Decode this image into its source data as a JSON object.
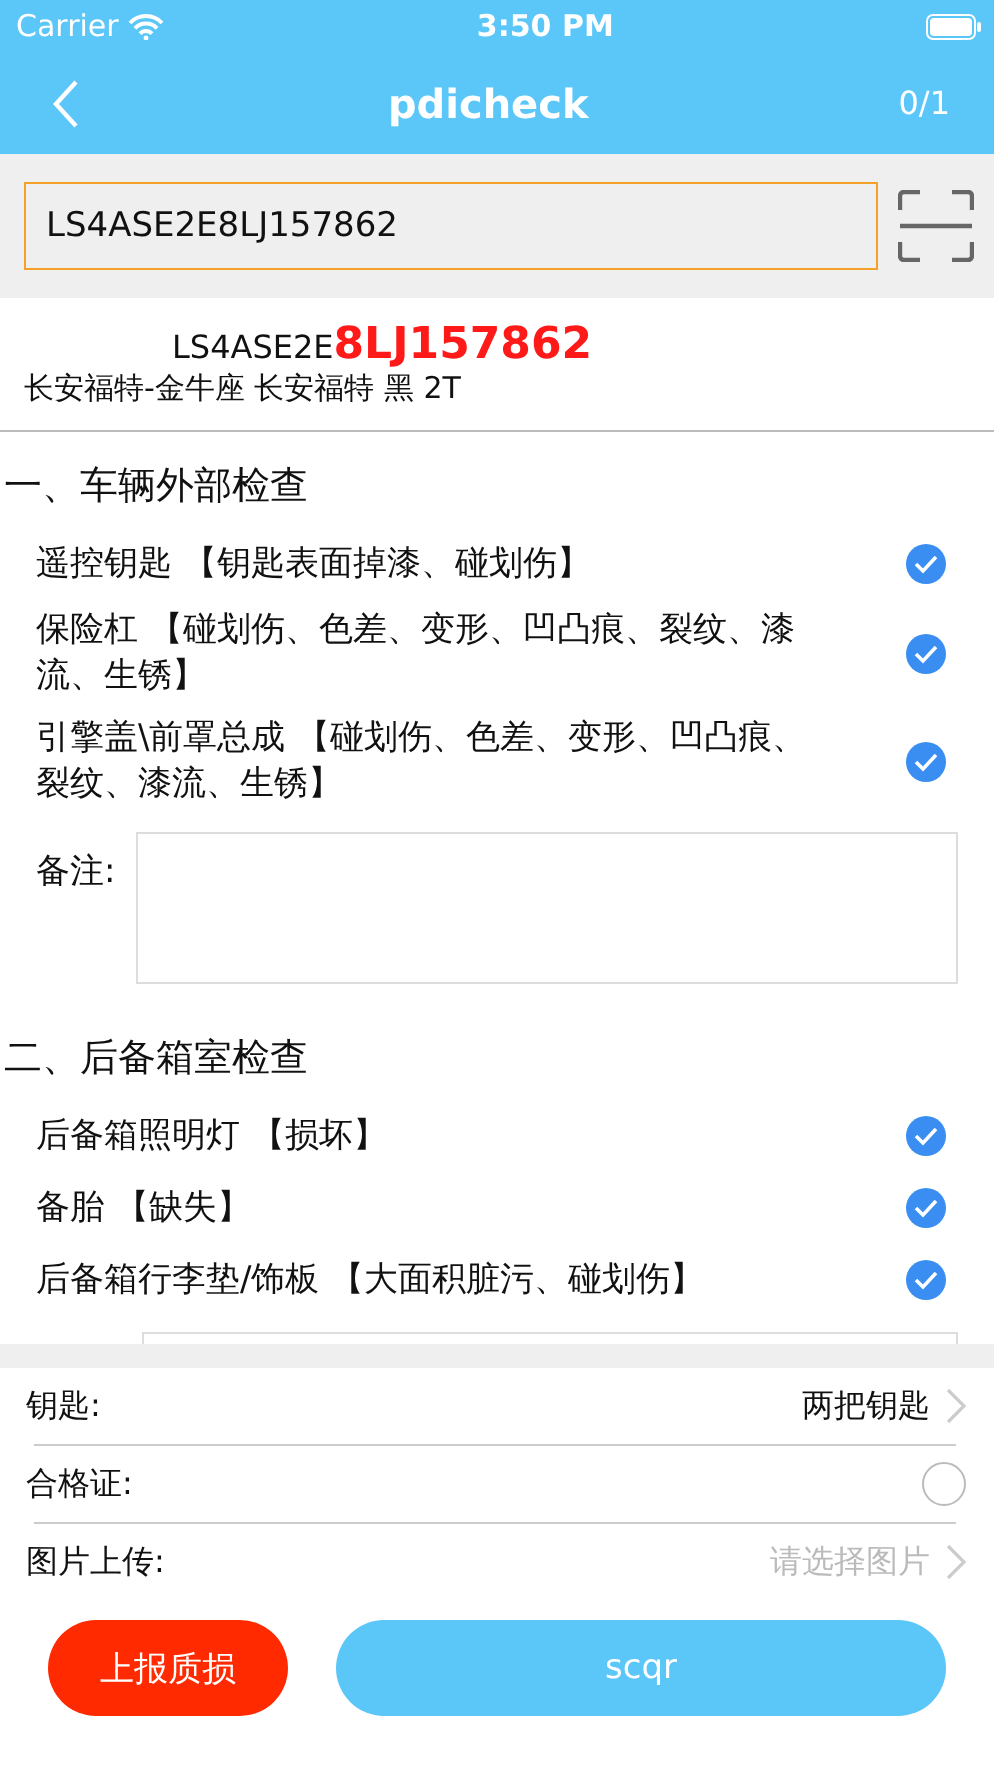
{
  "status_bar": {
    "carrier": "Carrier",
    "time": "3:50 PM"
  },
  "nav": {
    "title": "pdicheck",
    "counter": "0/1"
  },
  "search": {
    "value": "LS4ASE2E8LJ157862"
  },
  "vehicle": {
    "vin_prefix": "LS4ASE2E",
    "vin_suffix": "8LJ157862",
    "description": "长安福特-金牛座 长安福特  黑  2T"
  },
  "sections": [
    {
      "title": "一、车辆外部检查",
      "items": [
        {
          "label": "遥控钥匙 【钥匙表面掉漆、碰划伤】",
          "checked": true
        },
        {
          "label": "保险杠 【碰划伤、色差、变形、凹凸痕、裂纹、漆流、生锈】",
          "checked": true
        },
        {
          "label": "引擎盖\\前罩总成 【碰划伤、色差、变形、凹凸痕、裂纹、漆流、生锈】",
          "checked": true
        }
      ],
      "remark": {
        "kind": "labeled",
        "label": "备注:"
      }
    },
    {
      "title": "二、后备箱室检查",
      "items": [
        {
          "label": "后备箱照明灯 【损坏】",
          "checked": true
        },
        {
          "label": "备胎 【缺失】",
          "checked": true
        },
        {
          "label": "后备箱行李垫/饰板 【大面积脏污、碰划伤】",
          "checked": true
        }
      ],
      "remark": {
        "kind": "box"
      }
    }
  ],
  "form_rows": [
    {
      "kind": "select",
      "label": "钥匙:",
      "value": "两把钥匙"
    },
    {
      "kind": "toggle",
      "label": "合格证:",
      "checked": false
    },
    {
      "kind": "picker",
      "label": "图片上传:",
      "placeholder": "请选择图片"
    }
  ],
  "buttons": [
    {
      "kind": "danger",
      "label": "上报质损"
    },
    {
      "kind": "primary",
      "label": "scqr"
    }
  ]
}
